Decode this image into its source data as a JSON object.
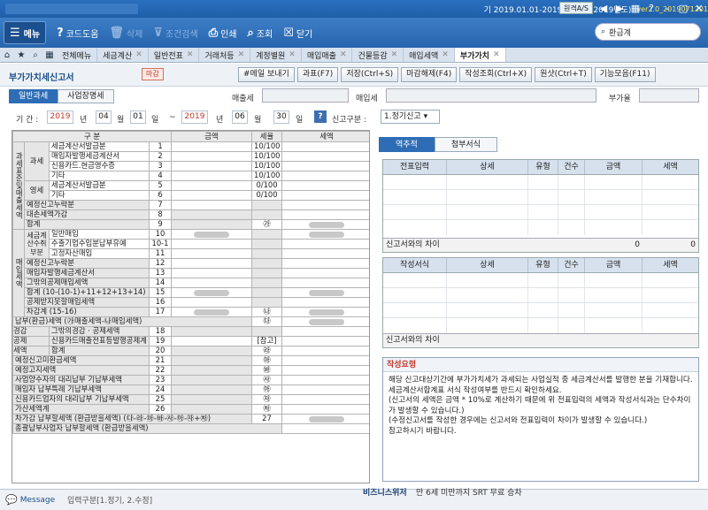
{
  "app": {
    "period": "기 2019.01.01-2019.12.31 (2019년도)",
    "version": "ver2.0_2019071201",
    "remote_btn": "원격A/S"
  },
  "toolbar": {
    "menu": "메뉴",
    "code_help": "코드도움",
    "delete": "삭제",
    "condition_search": "조건검색",
    "print": "인쇄",
    "query": "조회",
    "close": "닫기",
    "search_placeholder": "환급계"
  },
  "tabs": [
    {
      "label": "전체메뉴"
    },
    {
      "label": "세금계산"
    },
    {
      "label": "일반전표"
    },
    {
      "label": "거래처등"
    },
    {
      "label": "계정별원"
    },
    {
      "label": "매입매출"
    },
    {
      "label": "건물등감"
    },
    {
      "label": "매입세액"
    },
    {
      "label": "부가가치",
      "active": true
    }
  ],
  "form": {
    "title": "부가가치세신고서",
    "badge": "마감",
    "buttons": [
      "#메일 보내기",
      "과표(F7)",
      "저장(Ctrl+S)",
      "마감해제(F4)",
      "작성조회(Ctrl+X)",
      "원샷(Ctrl+T)",
      "기능모음(F11)"
    ],
    "subtab_general": "일반과세",
    "subtab_unit": "사업장명세",
    "sales_tax_label": "매출세",
    "purchase_tax_label": "매입세",
    "vat_rate_label": "부가율",
    "period_label": "기 간 :",
    "from_year": "2019",
    "from_month": "04",
    "from_day": "01",
    "to_year": "2019",
    "to_month": "06",
    "to_day": "30",
    "year_unit": "년",
    "month_unit": "월",
    "day_unit": "일",
    "tilde": "~",
    "help": "?",
    "report_type_label": "신고구분 :",
    "report_type_value": "1.정기신고"
  },
  "left_table": {
    "headers": {
      "section": "구 분",
      "amount": "금액",
      "rate": "세율",
      "tax": "세액"
    },
    "group_tax_base": "과세표준및매출세액",
    "group_taxable": "과세",
    "group_zero": "영세",
    "group_purchase": "매입세액",
    "group_purchase_sub": "세금계산수취부분",
    "rows": {
      "r1": {
        "label": "세금계산서발급분",
        "no": "1",
        "rate": "10/100"
      },
      "r2": {
        "label": "매입자발행세금계산서",
        "no": "2",
        "rate": "10/100"
      },
      "r3": {
        "label": "신용카드.현금영수증",
        "no": "3",
        "rate": "10/100"
      },
      "r4": {
        "label": "기타",
        "no": "4",
        "rate": "10/100"
      },
      "r5": {
        "label": "세금계산서발급분",
        "no": "5",
        "rate": "0/100"
      },
      "r6": {
        "label": "기타",
        "no": "6",
        "rate": "0/100"
      },
      "r7": {
        "label": "예정신고누락분",
        "no": "7"
      },
      "r8": {
        "label": "대손세액가감",
        "no": "8"
      },
      "r9": {
        "label": "합계",
        "no": "9",
        "rate": "㉮"
      },
      "r10": {
        "label": "일반매입",
        "no": "10"
      },
      "r10a": {
        "label": "수출기업수입분납부유예",
        "no": "10-1"
      },
      "r11": {
        "label": "고정자산매입",
        "no": "11"
      },
      "r12": {
        "label": "예정신고누락분",
        "no": "12"
      },
      "r13": {
        "label": "매입자발행세금계산서",
        "no": "13"
      },
      "r14": {
        "label": "그밖의공제매입세액",
        "no": "14"
      },
      "r15": {
        "label": "합계 (10-(10-1)+11+12+13+14)",
        "no": "15"
      },
      "r16": {
        "label": "공제받지못할매입세액",
        "no": "16"
      },
      "r17": {
        "label": "차감계 (15-16)",
        "no": "17",
        "rate": "㉯"
      },
      "r_pay": {
        "label": "납부(환급)세액 (㉮매출세액-㉯매입세액)",
        "rate": "㉰"
      },
      "r18": {
        "label": "그밖의경감 · 공제세액",
        "no": "18",
        "cat": "경감"
      },
      "r19": {
        "label": "신용카드매출전표등발행공제계",
        "no": "19",
        "cat": "공제",
        "rate": "[참고]"
      },
      "r20": {
        "label": "합계",
        "no": "20",
        "cat": "세액",
        "rate": "㉱"
      },
      "r21": {
        "label": "예정신고미환급세액",
        "no": "21",
        "rate": "㉲"
      },
      "r22": {
        "label": "예정고지세액",
        "no": "22",
        "rate": "㉳"
      },
      "r23": {
        "label": "사업양수자의 대리납부 기납부세액",
        "no": "23",
        "rate": "㉴"
      },
      "r24": {
        "label": "매입자 납부특례 기납부세액",
        "no": "24",
        "rate": "㉵"
      },
      "r25": {
        "label": "신용카드업자의 대리납부 기납부세액",
        "no": "25",
        "rate": "㉶"
      },
      "r26": {
        "label": "가산세액계",
        "no": "26",
        "rate": "㉷"
      },
      "r27": {
        "label": "차가감 납부할세액 (환급받을세액) (㉰-㉱-㉲-㉳-㉴-㉵-㉶+㉷)",
        "no": "27"
      },
      "r_total": {
        "label": "총괄납부사업자 납부할세액 (환급받을세액)"
      }
    }
  },
  "right": {
    "tab_accum": "역추적",
    "tab_attach": "첨부서식",
    "grid1": {
      "headers": [
        "전표입력",
        "상세",
        "유형",
        "건수",
        "금액",
        "세액"
      ],
      "diff_label": "신고서와의 차이",
      "diff_amount": "0",
      "diff_tax": "0"
    },
    "grid2": {
      "headers": [
        "작성서식",
        "상세",
        "유형",
        "건수",
        "금액",
        "세액"
      ],
      "diff_label": "신고서와의 차이"
    },
    "guide_title": "작성요령",
    "guide_text": "해당 신고대상기간에 부가가치세가 과세되는 사업실적 중 세금계산서를 발행한 분을 기재합니다. 세금계산서합계표 서식 작성여부를 반드시 확인하세요.\n(신고서의 세액은 금액 * 10%로 계산하기 때문에 위 전표입력의 세액과 작성서식과는 단수차이가 발생할 수 있습니다.)\n(수정신고서를 작성한 경우에는 신고서와 전표입력이 차이가 발생할 수 있습니다.)\n참고하시기 바랍니다."
  },
  "status": {
    "message": "Message",
    "message_text": "입력구분[1.정기, 2.수정]",
    "biz_label": "비즈니스위저",
    "biz_value": "만 6세 미만까지 SRT 무료 승차"
  },
  "colors": {
    "accent": "#2e6db5",
    "title_bar": "#1f5fa8",
    "red": "#c0392b"
  }
}
